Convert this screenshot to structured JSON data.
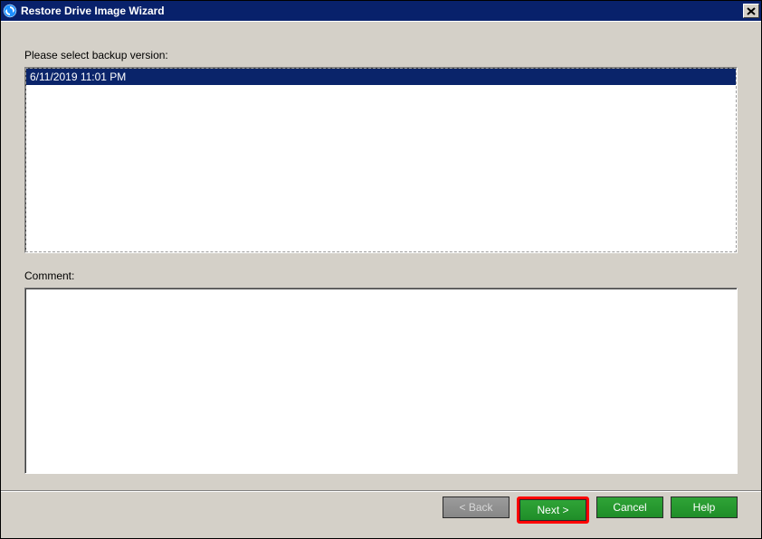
{
  "window": {
    "title": "Restore Drive Image Wizard"
  },
  "labels": {
    "select_backup": "Please select backup version:",
    "comment": "Comment:"
  },
  "backup_list": {
    "items": [
      "6/11/2019 11:01 PM"
    ]
  },
  "comment": "",
  "buttons": {
    "back": "< Back",
    "next": "Next >",
    "cancel": "Cancel",
    "help": "Help"
  }
}
